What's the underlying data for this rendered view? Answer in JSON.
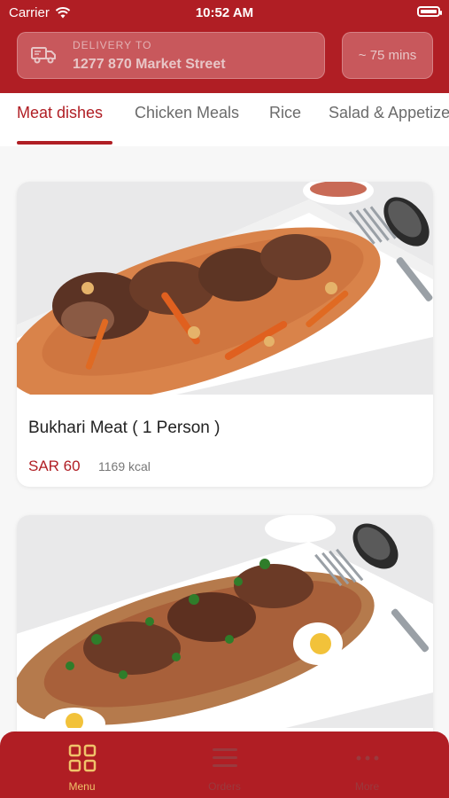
{
  "status_bar": {
    "carrier": "Carrier",
    "time": "10:52 AM"
  },
  "header": {
    "delivery_label": "DELIVERY TO",
    "delivery_address": "1277 870 Market Street",
    "eta": "~ 75 mins",
    "icons": {
      "delivery": "truck-icon",
      "wifi": "wifi-icon",
      "battery": "battery-icon"
    }
  },
  "tabs": [
    {
      "label": "Meat dishes",
      "active": true
    },
    {
      "label": "Chicken Meals",
      "active": false
    },
    {
      "label": "Rice",
      "active": false
    },
    {
      "label": "Salad & Appetizers",
      "active": false
    }
  ],
  "menu_items": [
    {
      "name": "Bukhari Meat ( 1 Person )",
      "price": "SAR 60",
      "kcal": "1169 kcal"
    },
    {
      "name": "",
      "price": "",
      "kcal": ""
    }
  ],
  "bottom_nav": [
    {
      "label": "Menu",
      "icon": "grid-icon",
      "active": true
    },
    {
      "label": "Orders",
      "icon": "list-icon",
      "active": false
    },
    {
      "label": "More",
      "icon": "more-icon",
      "active": false
    }
  ],
  "colors": {
    "brand": "#b01e24",
    "active_nav": "#f0c36a",
    "price": "#b01e24"
  }
}
